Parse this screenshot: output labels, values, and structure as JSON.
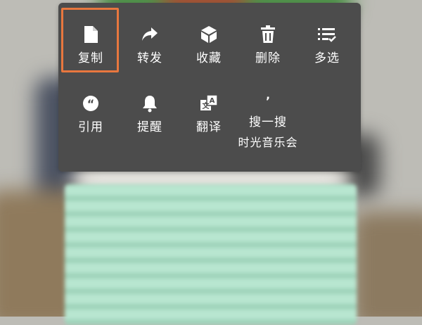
{
  "menu": {
    "items": [
      {
        "label": "复制",
        "icon": "document-icon"
      },
      {
        "label": "转发",
        "icon": "forward-arrow-icon"
      },
      {
        "label": "收藏",
        "icon": "cube-icon"
      },
      {
        "label": "删除",
        "icon": "trash-icon"
      },
      {
        "label": "多选",
        "icon": "checklist-icon"
      },
      {
        "label": "引用",
        "icon": "quote-icon"
      },
      {
        "label": "提醒",
        "icon": "bell-icon"
      },
      {
        "label": "翻译",
        "icon": "translate-icon"
      },
      {
        "label": "搜一搜",
        "sub": "时光音乐会",
        "icon": "apostrophe-icon",
        "icon_text": "’"
      }
    ],
    "highlight_color": "#e8773e",
    "background_color": "#4c4c4c"
  }
}
